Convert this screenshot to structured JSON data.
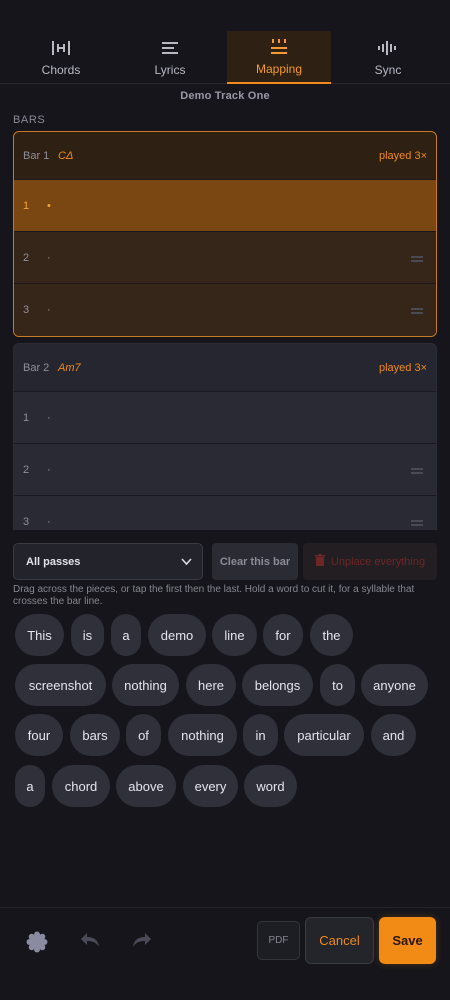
{
  "tabs": [
    {
      "label": "Chords",
      "icon": "chords-icon"
    },
    {
      "label": "Lyrics",
      "icon": "lyrics-icon"
    },
    {
      "label": "Mapping",
      "icon": "mapping-icon",
      "active": true
    },
    {
      "label": "Sync",
      "icon": "sync-waveform-icon"
    }
  ],
  "track_title": "Demo Track One",
  "section_label": "BARS",
  "bars": [
    {
      "name": "Bar 1",
      "chord": "CΔ",
      "played": "played 3×",
      "rows": [
        {
          "num": "1",
          "dot": "•"
        },
        {
          "num": "2",
          "dot": "·"
        },
        {
          "num": "3",
          "dot": "·"
        }
      ]
    },
    {
      "name": "Bar 2",
      "chord": "Am7",
      "played": "played 3×",
      "rows": [
        {
          "num": "1",
          "dot": "·"
        },
        {
          "num": "2",
          "dot": "·"
        },
        {
          "num": "3",
          "dot": "·"
        }
      ]
    }
  ],
  "controls": {
    "passes_select": "All passes",
    "clear_bar": "Clear this bar",
    "unplace_all": "Unplace everything"
  },
  "hint": "Drag across the pieces, or tap the first then the last. Hold a word to cut it, for a syllable that crosses the bar line.",
  "words": [
    "This",
    "is",
    "a",
    "demo",
    "line",
    "for",
    "the",
    "screenshot",
    "nothing",
    "here",
    "belongs",
    "to",
    "anyone",
    "four",
    "bars",
    "of",
    "nothing",
    "in",
    "particular",
    "and",
    "a",
    "chord",
    "above",
    "every",
    "word"
  ],
  "bottom": {
    "pdf": "PDF",
    "cancel": "Cancel",
    "save": "Save"
  },
  "colors": {
    "accent": "#f08a1c",
    "background": "#15151b",
    "danger": "#6e2626"
  }
}
